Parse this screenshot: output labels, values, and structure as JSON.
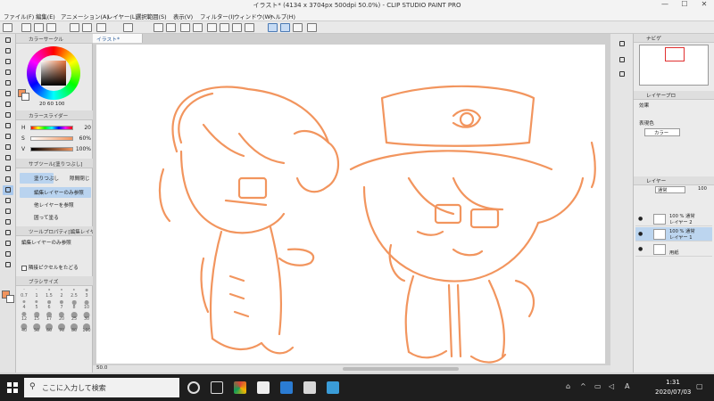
{
  "window": {
    "title": "イラスト* (4134 x 3704px 500dpi 50.0%)  - CLIP STUDIO PAINT PRO",
    "minimize": "—",
    "maximize": "☐",
    "close": "✕"
  },
  "menu": [
    "ファイル(F)",
    "編集(E)",
    "アニメーション(A)",
    "レイヤー(L)",
    "選択範囲(S)",
    "表示(V)",
    "フィルター(I)",
    "ウィンドウ(W)",
    "ヘルプ(H)"
  ],
  "left": {
    "color_wheel_title": "カラーサークル",
    "hsv_readout": {
      "h": "20",
      "s": "60",
      "v": "100"
    },
    "color_slider_title": "カラースライダー",
    "sliders": [
      {
        "label": "H",
        "value": "20"
      },
      {
        "label": "S",
        "value": "60%"
      },
      {
        "label": "V",
        "value": "100%"
      }
    ],
    "subtool_title": "サブツール[塗りつぶし]",
    "subtool_tabs": [
      "塗りつぶし",
      "隙間閉じ"
    ],
    "subtools": [
      "編集レイヤーのみ参照",
      "他レイヤーを参照",
      "囲って塗る"
    ],
    "tool_prop_title": "ツールプロパティ[編集レイヤー]",
    "tool_prop_item": "編集レイヤーのみ参照",
    "adjacent_label": "隣接ピクセルをたどる",
    "brush_size_title": "ブラシサイズ",
    "brush_sizes": [
      "0.7",
      "1",
      "1.5",
      "2",
      "2.5",
      "3",
      "4",
      "5",
      "6",
      "7",
      "8",
      "10",
      "12",
      "15",
      "17",
      "20",
      "25",
      "30",
      "40",
      "50",
      "60",
      "70",
      "80",
      "100"
    ]
  },
  "canvas": {
    "tab_label": "イラスト*",
    "zoom": "50.0",
    "accent": "#f2955e"
  },
  "right": {
    "navigator_title": "ナビゲ",
    "layer_prop_title": "レイヤープロ",
    "effect_label": "効果",
    "display_color_label": "表現色",
    "display_color_value": "カラー",
    "layer_tab": "レイヤー",
    "blend_mode": "通常",
    "opacity": "100",
    "layers": [
      {
        "line1": "100 % 通常",
        "line2": "レイヤー 2",
        "selected": false
      },
      {
        "line1": "100 % 通常",
        "line2": "レイヤー 1",
        "selected": true
      },
      {
        "line1": "",
        "line2": "用紙",
        "selected": false
      }
    ]
  },
  "taskbar": {
    "search_placeholder": "ここに入力して検索",
    "time": "1:31",
    "date": "2020/07/03",
    "ime": "A"
  }
}
